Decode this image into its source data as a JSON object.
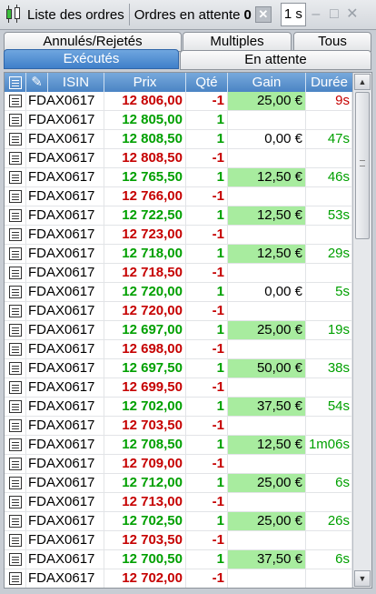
{
  "window": {
    "title": "Liste des ordres",
    "pending_label": "Ordres en attente",
    "pending_count": "0",
    "clear_icon": "close-icon",
    "interval_value": "1 s",
    "controls": [
      "minimize-icon",
      "maximize-icon",
      "close-icon"
    ]
  },
  "tabs": {
    "annules": "Annulés/Rejetés",
    "multiples": "Multiples",
    "tous": "Tous",
    "executes": "Exécutés",
    "attente": "En attente"
  },
  "columns": {
    "isin": "ISIN",
    "prix": "Prix",
    "qte": "Qté",
    "gain": "Gain",
    "duree": "Durée"
  },
  "colors": {
    "buy": "#00a000",
    "sell": "#c60000",
    "gain_bg": "#a8ec9f",
    "header": "#4b84c4"
  },
  "rows": [
    {
      "isin": "FDAX0617",
      "prix": "12 806,00",
      "side": "sell",
      "qte": "-1",
      "gain": "25,00 €",
      "gain_hl": true,
      "duree": "9s",
      "dur_color": "sell"
    },
    {
      "isin": "FDAX0617",
      "prix": "12 805,00",
      "side": "buy",
      "qte": "1",
      "gain": "",
      "gain_hl": false,
      "duree": "",
      "dur_color": "buy"
    },
    {
      "isin": "FDAX0617",
      "prix": "12 808,50",
      "side": "buy",
      "qte": "1",
      "gain": "0,00 €",
      "gain_hl": false,
      "duree": "47s",
      "dur_color": "buy"
    },
    {
      "isin": "FDAX0617",
      "prix": "12 808,50",
      "side": "sell",
      "qte": "-1",
      "gain": "",
      "gain_hl": false,
      "duree": "",
      "dur_color": "buy"
    },
    {
      "isin": "FDAX0617",
      "prix": "12 765,50",
      "side": "buy",
      "qte": "1",
      "gain": "12,50 €",
      "gain_hl": true,
      "duree": "46s",
      "dur_color": "buy"
    },
    {
      "isin": "FDAX0617",
      "prix": "12 766,00",
      "side": "sell",
      "qte": "-1",
      "gain": "",
      "gain_hl": false,
      "duree": "",
      "dur_color": "buy"
    },
    {
      "isin": "FDAX0617",
      "prix": "12 722,50",
      "side": "buy",
      "qte": "1",
      "gain": "12,50 €",
      "gain_hl": true,
      "duree": "53s",
      "dur_color": "buy"
    },
    {
      "isin": "FDAX0617",
      "prix": "12 723,00",
      "side": "sell",
      "qte": "-1",
      "gain": "",
      "gain_hl": false,
      "duree": "",
      "dur_color": "buy"
    },
    {
      "isin": "FDAX0617",
      "prix": "12 718,00",
      "side": "buy",
      "qte": "1",
      "gain": "12,50 €",
      "gain_hl": true,
      "duree": "29s",
      "dur_color": "buy"
    },
    {
      "isin": "FDAX0617",
      "prix": "12 718,50",
      "side": "sell",
      "qte": "-1",
      "gain": "",
      "gain_hl": false,
      "duree": "",
      "dur_color": "buy"
    },
    {
      "isin": "FDAX0617",
      "prix": "12 720,00",
      "side": "buy",
      "qte": "1",
      "gain": "0,00 €",
      "gain_hl": false,
      "duree": "5s",
      "dur_color": "buy"
    },
    {
      "isin": "FDAX0617",
      "prix": "12 720,00",
      "side": "sell",
      "qte": "-1",
      "gain": "",
      "gain_hl": false,
      "duree": "",
      "dur_color": "buy"
    },
    {
      "isin": "FDAX0617",
      "prix": "12 697,00",
      "side": "buy",
      "qte": "1",
      "gain": "25,00 €",
      "gain_hl": true,
      "duree": "19s",
      "dur_color": "buy"
    },
    {
      "isin": "FDAX0617",
      "prix": "12 698,00",
      "side": "sell",
      "qte": "-1",
      "gain": "",
      "gain_hl": false,
      "duree": "",
      "dur_color": "buy"
    },
    {
      "isin": "FDAX0617",
      "prix": "12 697,50",
      "side": "buy",
      "qte": "1",
      "gain": "50,00 €",
      "gain_hl": true,
      "duree": "38s",
      "dur_color": "buy"
    },
    {
      "isin": "FDAX0617",
      "prix": "12 699,50",
      "side": "sell",
      "qte": "-1",
      "gain": "",
      "gain_hl": false,
      "duree": "",
      "dur_color": "buy"
    },
    {
      "isin": "FDAX0617",
      "prix": "12 702,00",
      "side": "buy",
      "qte": "1",
      "gain": "37,50 €",
      "gain_hl": true,
      "duree": "54s",
      "dur_color": "buy"
    },
    {
      "isin": "FDAX0617",
      "prix": "12 703,50",
      "side": "sell",
      "qte": "-1",
      "gain": "",
      "gain_hl": false,
      "duree": "",
      "dur_color": "buy"
    },
    {
      "isin": "FDAX0617",
      "prix": "12 708,50",
      "side": "buy",
      "qte": "1",
      "gain": "12,50 €",
      "gain_hl": true,
      "duree": "1m06s",
      "dur_color": "buy"
    },
    {
      "isin": "FDAX0617",
      "prix": "12 709,00",
      "side": "sell",
      "qte": "-1",
      "gain": "",
      "gain_hl": false,
      "duree": "",
      "dur_color": "buy"
    },
    {
      "isin": "FDAX0617",
      "prix": "12 712,00",
      "side": "buy",
      "qte": "1",
      "gain": "25,00 €",
      "gain_hl": true,
      "duree": "6s",
      "dur_color": "buy"
    },
    {
      "isin": "FDAX0617",
      "prix": "12 713,00",
      "side": "sell",
      "qte": "-1",
      "gain": "",
      "gain_hl": false,
      "duree": "",
      "dur_color": "buy"
    },
    {
      "isin": "FDAX0617",
      "prix": "12 702,50",
      "side": "buy",
      "qte": "1",
      "gain": "25,00 €",
      "gain_hl": true,
      "duree": "26s",
      "dur_color": "buy"
    },
    {
      "isin": "FDAX0617",
      "prix": "12 703,50",
      "side": "sell",
      "qte": "-1",
      "gain": "",
      "gain_hl": false,
      "duree": "",
      "dur_color": "buy"
    },
    {
      "isin": "FDAX0617",
      "prix": "12 700,50",
      "side": "buy",
      "qte": "1",
      "gain": "37,50 €",
      "gain_hl": true,
      "duree": "6s",
      "dur_color": "buy"
    },
    {
      "isin": "FDAX0617",
      "prix": "12 702,00",
      "side": "sell",
      "qte": "-1",
      "gain": "",
      "gain_hl": false,
      "duree": "",
      "dur_color": "buy"
    }
  ]
}
